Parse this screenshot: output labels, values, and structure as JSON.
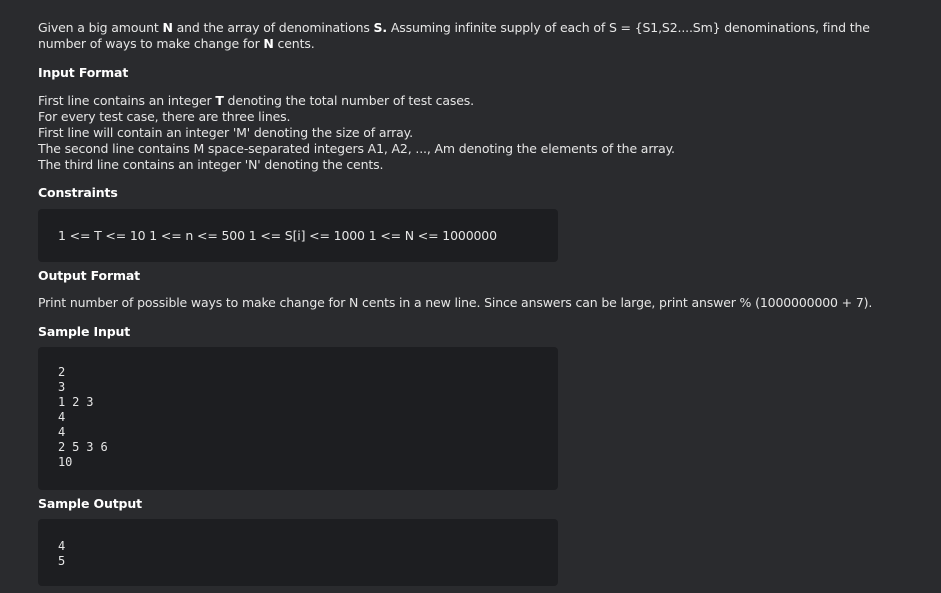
{
  "intro": {
    "part1": "Given a big amount ",
    "n": "N",
    "part2": " and the array of denominations ",
    "s": "S.",
    "part3": " Assuming infinite supply of each of S = {S1,S2....Sm} denominations, find the number of ways to make change for ",
    "n2": "N",
    "part4": " cents."
  },
  "input_format": {
    "heading": "Input Format",
    "line1_pre": "First line contains an integer ",
    "line1_t": "T",
    "line1_post": " denoting the total number of test cases.",
    "line2": "For every test case, there are three lines.",
    "line3": "First line will contain an integer 'M' denoting the size of array.",
    "line4": "The second line contains M space-separated integers A1, A2, ..., Am denoting the elements of the array.",
    "line5": "The third line contains an integer 'N' denoting the cents."
  },
  "constraints": {
    "heading": "Constraints",
    "text": "1 <= T <= 10 1 <= n <= 500 1 <= S[i] <= 1000 1 <= N <= 1000000"
  },
  "output_format": {
    "heading": "Output Format",
    "text": "Print number of possible ways to make change for N cents in a new line. Since answers can be large, print answer % (1000000000 + 7)."
  },
  "sample_input": {
    "heading": "Sample Input",
    "lines": [
      "2",
      "3",
      "1 2 3",
      "4",
      "4",
      "2 5 3 6",
      "10"
    ]
  },
  "sample_output": {
    "heading": "Sample Output",
    "lines": [
      "4",
      "5"
    ]
  }
}
